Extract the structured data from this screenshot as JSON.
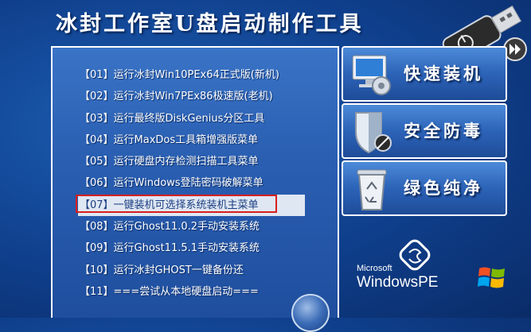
{
  "header": {
    "title": "冰封工作室U盘启动制作工具"
  },
  "menu": {
    "items": [
      {
        "label": "【01】运行冰封Win10PEx64正式版(新机)",
        "selected": false
      },
      {
        "label": "【02】运行冰封Win7PEx86极速版(老机)",
        "selected": false
      },
      {
        "label": "【03】运行最终版DiskGenius分区工具",
        "selected": false
      },
      {
        "label": "【04】运行MaxDos工具箱增强版菜单",
        "selected": false
      },
      {
        "label": "【05】运行硬盘内存检测扫描工具菜单",
        "selected": false
      },
      {
        "label": "【06】运行Windows登陆密码破解菜单",
        "selected": false
      },
      {
        "label": "【07】一键装机可选择系统装机主菜单",
        "selected": true
      },
      {
        "label": "【08】运行Ghost11.0.2手动安装系统",
        "selected": false
      },
      {
        "label": "【09】运行Ghost11.5.1手动安装系统",
        "selected": false
      },
      {
        "label": "【10】运行冰封GHOST一键备份还",
        "selected": false
      },
      {
        "label": "【11】===尝试从本地硬盘启动===",
        "selected": false
      }
    ]
  },
  "side_buttons": [
    {
      "label": "快速装机",
      "icon": "computer-gear-icon"
    },
    {
      "label": "安全防毒",
      "icon": "shield-icon"
    },
    {
      "label": "绿色纯净",
      "icon": "recycle-bin-icon"
    }
  ],
  "branding": {
    "microsoft": "Microsoft",
    "product": "WindowsPE"
  },
  "colors": {
    "background": "#1d5fb4",
    "selected_border": "#d81e1e",
    "selected_bg": "#dfe7f3"
  }
}
